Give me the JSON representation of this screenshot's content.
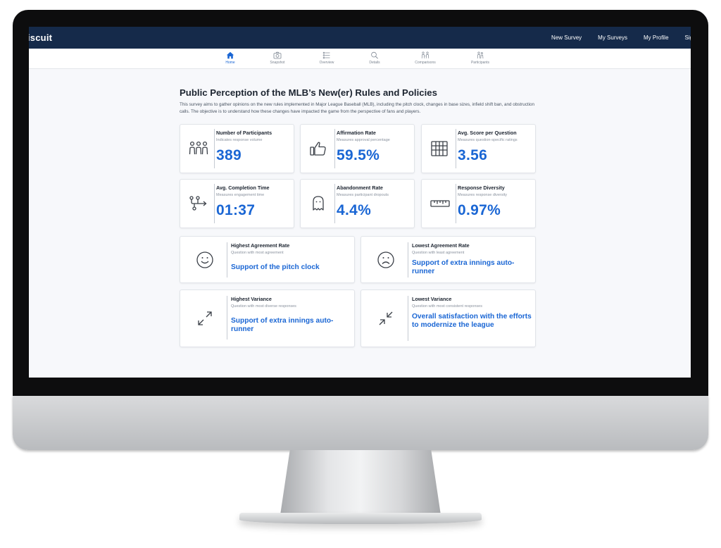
{
  "app": {
    "brand": "iscuit"
  },
  "topnav": [
    "New Survey",
    "My Surveys",
    "My Profile",
    "Sign O"
  ],
  "tabs": [
    {
      "label": "Home",
      "icon": "home-icon",
      "active": true
    },
    {
      "label": "Snapshot",
      "icon": "camera-icon",
      "active": false
    },
    {
      "label": "Overview",
      "icon": "overview-icon",
      "active": false
    },
    {
      "label": "Details",
      "icon": "search-icon",
      "active": false
    },
    {
      "label": "Comparisons",
      "icon": "comparison-people-icon",
      "active": false
    },
    {
      "label": "Participants",
      "icon": "participants-icon",
      "active": false
    }
  ],
  "survey": {
    "title": "Public Perception of the MLB’s New(er) Rules and Policies",
    "description": "This survey aims to gather opinions on the new rules implemented in Major League Baseball (MLB), including the pitch clock, changes in base sizes, infield shift ban, and obstruction calls. The objective is to understand how these changes have impacted the game from the perspective of fans and players."
  },
  "metrics": [
    {
      "title": "Number of Participants",
      "subtitle": "Indicates response volume",
      "value": "389",
      "icon": "group-of-people-icon"
    },
    {
      "title": "Affirmation Rate",
      "subtitle": "Measures approval percentage",
      "value": "59.5%",
      "icon": "thumbs-up-icon"
    },
    {
      "title": "Avg. Score per Question",
      "subtitle": "Measures question-specific ratings",
      "value": "3.56",
      "icon": "abacus-icon"
    },
    {
      "title": "Avg. Completion Time",
      "subtitle": "Measures engagement time",
      "value": "01:37",
      "icon": "journey-path-icon"
    },
    {
      "title": "Abandonment Rate",
      "subtitle": "Measures participant dropouts",
      "value": "4.4%",
      "icon": "ghost-icon"
    },
    {
      "title": "Response Diversity",
      "subtitle": "Measures response diversity",
      "value": "0.97%",
      "icon": "ruler-icon"
    }
  ],
  "insights": [
    {
      "title": "Highest Agreement Rate",
      "subtitle": "Question with most agreement",
      "text": "Support of the pitch clock",
      "icon": "smiley-face-icon"
    },
    {
      "title": "Lowest Agreement Rate",
      "subtitle": "Question with least agreement",
      "text": "Support of extra innings auto-runner",
      "icon": "sad-face-icon"
    },
    {
      "title": "Highest Variance",
      "subtitle": "Question with most diverse responses",
      "text": "Support of extra innings auto-runner",
      "icon": "expand-arrows-icon"
    },
    {
      "title": "Lowest Variance",
      "subtitle": "Question with most consistent responses",
      "text": "Overall satisfaction with the efforts to modernize the league",
      "icon": "collapse-arrows-icon"
    }
  ],
  "colors": {
    "navbar": "#152a4a",
    "accent": "#1a66d4",
    "background": "#f7f8fb"
  }
}
